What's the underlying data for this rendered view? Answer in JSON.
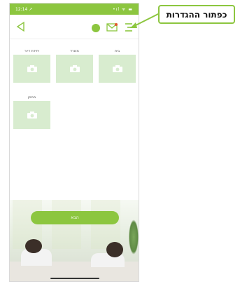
{
  "statusbar": {
    "time": "12:14 ↗",
    "indicators": "•ıl ᯤ ▬"
  },
  "toolbar": {
    "back_icon": "back-triangle-icon",
    "status_icon": "green-dot-icon",
    "mail_icon": "mail-icon",
    "menu_icon": "settings-menu-icon"
  },
  "tiles": [
    {
      "label": "בית"
    },
    {
      "label": "משרד"
    },
    {
      "label": "יחידת דיור"
    },
    {
      "label": "מחסן"
    }
  ],
  "cta": {
    "label": "הבא"
  },
  "annotation": {
    "label": "כפתור ההגדרות"
  },
  "colors": {
    "accent": "#8cc63f",
    "tile": "#d8eccf"
  }
}
